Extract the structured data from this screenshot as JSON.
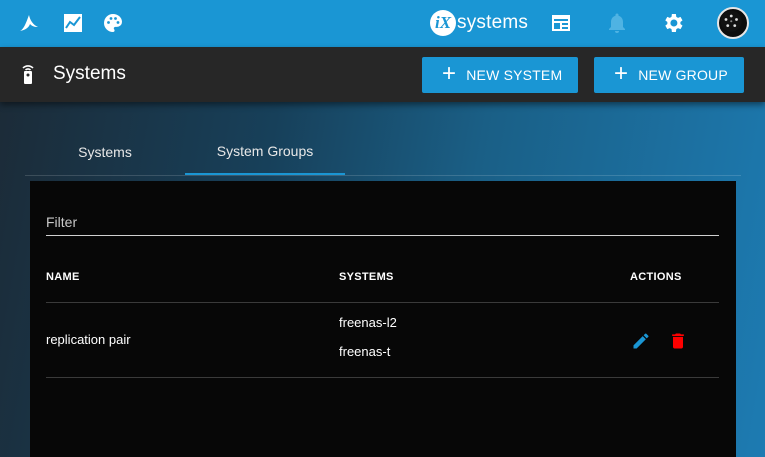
{
  "topbar": {
    "logo_icon": "freenas-logo-icon",
    "icons": [
      "chart-icon",
      "palette-icon",
      "dashboard-icon",
      "bell-icon",
      "gear-icon"
    ],
    "brand_mark": "iX",
    "brand_text": "systems",
    "accent_color": "#1a96d4"
  },
  "header": {
    "title": "Systems",
    "icon": "remote-icon",
    "new_system_label": "NEW SYSTEM",
    "new_group_label": "NEW GROUP"
  },
  "tabs": [
    {
      "label": "Systems",
      "active": false
    },
    {
      "label": "System Groups",
      "active": true
    }
  ],
  "table": {
    "filter_placeholder": "Filter",
    "columns": [
      "NAME",
      "SYSTEMS",
      "ACTIONS"
    ],
    "rows": [
      {
        "name": "replication pair",
        "systems": [
          "freenas-l2",
          "freenas-t"
        ],
        "actions": [
          "edit-icon",
          "delete-icon"
        ]
      }
    ]
  },
  "colors": {
    "delete": "#ff0000",
    "edit": "#1a96d4",
    "header_bg": "#272727",
    "card_bg": "#070707"
  }
}
